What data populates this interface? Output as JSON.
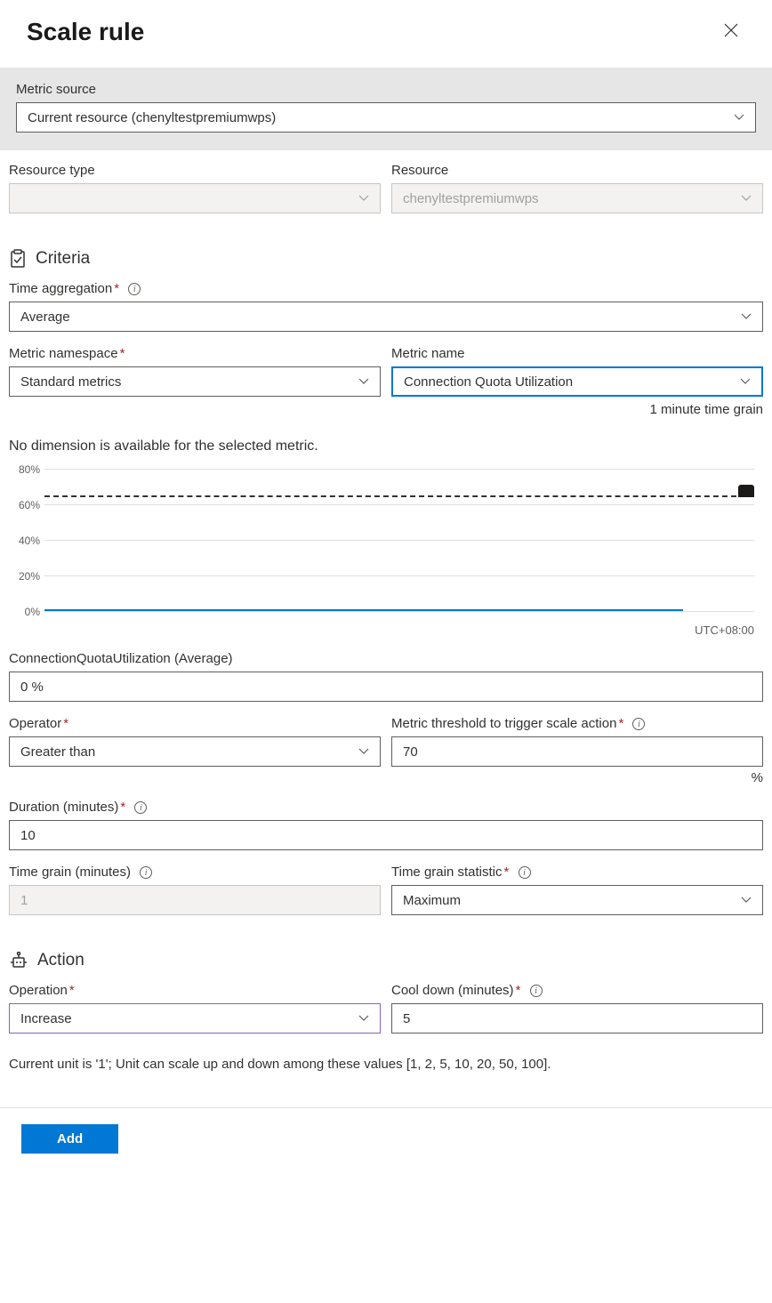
{
  "header": {
    "title": "Scale rule"
  },
  "metricSource": {
    "label": "Metric source",
    "value": "Current resource (chenyltestpremiumwps)"
  },
  "resourceType": {
    "label": "Resource type",
    "value": ""
  },
  "resource": {
    "label": "Resource",
    "value": "chenyltestpremiumwps"
  },
  "criteria": {
    "heading": "Criteria",
    "timeAggregation": {
      "label": "Time aggregation",
      "value": "Average"
    },
    "metricNamespace": {
      "label": "Metric namespace",
      "value": "Standard metrics"
    },
    "metricName": {
      "label": "Metric name",
      "value": "Connection Quota Utilization",
      "helper": "1 minute time grain"
    },
    "noDimensionText": "No dimension is available for the selected metric.",
    "currentMetric": {
      "label": "ConnectionQuotaUtilization (Average)",
      "value": "0 %"
    },
    "operator": {
      "label": "Operator",
      "value": "Greater than"
    },
    "threshold": {
      "label": "Metric threshold to trigger scale action",
      "value": "70",
      "unit": "%"
    },
    "duration": {
      "label": "Duration (minutes)",
      "value": "10"
    },
    "timeGrain": {
      "label": "Time grain (minutes)",
      "value": "1"
    },
    "timeGrainStatistic": {
      "label": "Time grain statistic",
      "value": "Maximum"
    }
  },
  "action": {
    "heading": "Action",
    "operation": {
      "label": "Operation",
      "value": "Increase"
    },
    "coolDown": {
      "label": "Cool down (minutes)",
      "value": "5"
    },
    "unitNote": "Current unit is '1'; Unit can scale up and down among these values [1, 2, 5, 10, 20, 50, 100]."
  },
  "footer": {
    "addButton": "Add"
  },
  "chart_data": {
    "type": "line",
    "title": "",
    "ylabel": "",
    "ylim": [
      0,
      80
    ],
    "yticks": [
      "0%",
      "20%",
      "40%",
      "60%",
      "80%"
    ],
    "threshold_line": 70,
    "series": [
      {
        "name": "ConnectionQuotaUtilization",
        "value_flat": 0
      }
    ],
    "timezone": "UTC+08:00"
  }
}
